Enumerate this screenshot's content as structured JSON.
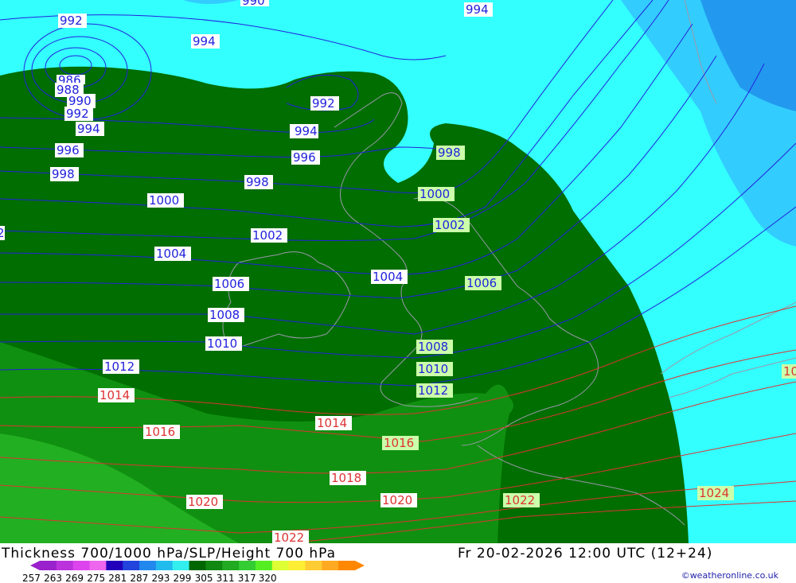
{
  "footer": {
    "title": "Thickness 700/1000 hPa/SLP/Height 700 hPa",
    "valid_time": "Fr 20-02-2026 12:00 UTC (12+24)",
    "credit": "©weatheronline.co.uk"
  },
  "colors": {
    "slp_isobar": "#2222dd",
    "high_isobar": "#dd3333",
    "label_bg_land": "#ccffaa",
    "label_bg_sea": "#ffffff",
    "coast": "#9999aa"
  },
  "legend": {
    "ticks": [
      "257",
      "263",
      "269",
      "275",
      "281",
      "287",
      "293",
      "299",
      "305",
      "311",
      "317",
      "320"
    ],
    "colors": [
      "#9922cc",
      "#bb33dd",
      "#dd44ee",
      "#ee66ee",
      "#2200bb",
      "#2244dd",
      "#2288ee",
      "#22bbee",
      "#33eeee",
      "#006600",
      "#118811",
      "#22aa22",
      "#33cc33",
      "#55ee22",
      "#ddff33",
      "#ffee33",
      "#ffcc33",
      "#ffaa22",
      "#ff8800"
    ]
  },
  "isobar_labels": {
    "blue": [
      "992",
      "990",
      "994",
      "994",
      "992",
      "986",
      "988",
      "990",
      "992",
      "994",
      "996",
      "998",
      "1000",
      "1002",
      "1004",
      "1006",
      "1008",
      "1010",
      "1012",
      "992",
      "994",
      "996",
      "998",
      "1002",
      "1004",
      "2"
    ],
    "green": [
      "998",
      "1000",
      "1002",
      "1006",
      "1008",
      "1010",
      "1012",
      "1016",
      "1022",
      "1024"
    ],
    "red": [
      "1014",
      "1014",
      "1016",
      "1018",
      "1020",
      "1020",
      "1022",
      "10"
    ]
  }
}
